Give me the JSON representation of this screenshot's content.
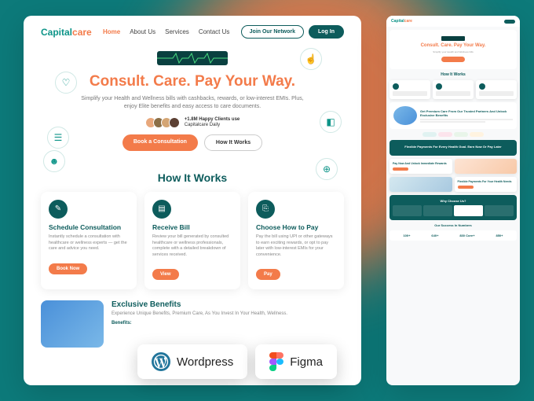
{
  "brand": {
    "part1": "Capital",
    "part2": "care"
  },
  "nav": {
    "items": [
      "Home",
      "About Us",
      "Services",
      "Contact Us"
    ]
  },
  "header_buttons": {
    "join": "Join Our Network",
    "login": "Log In"
  },
  "hero": {
    "title": "Consult. Care. Pay Your Way.",
    "subtitle": "Simplify your Health and Wellness bills with cashbacks, rewards, or low-interest EMIs. Plus, enjoy Elite benefits and easy access to care documents.",
    "social_proof_line1": "+1.8M Happy Clients use",
    "social_proof_line2": "Capitalcare Daily",
    "cta_primary": "Book a Consultation",
    "cta_secondary": "How It Works"
  },
  "how_it_works": {
    "title": "How It Works",
    "cards": [
      {
        "title": "Schedule Consultation",
        "desc": "Instantly schedule a consultation with healthcare or wellness experts — get the care and advice you need.",
        "btn": "Book Now"
      },
      {
        "title": "Receive Bill",
        "desc": "Review your bill generated by consulted healthcare or wellness professionals, complete with a detailed breakdown of services received.",
        "btn": "View"
      },
      {
        "title": "Choose How to Pay",
        "desc": "Pay the bill using UPI or other gateways to earn exciting rewards, or opt to pay later with low-interest EMIs for your convenience.",
        "btn": "Pay"
      }
    ]
  },
  "benefits": {
    "title": "Exclusive Benefits",
    "subtitle": "Experience Unique Benefits, Premium Care, As You Invest In Your Health, Wellness.",
    "label": "Benefits:"
  },
  "tools": {
    "wordpress": "Wordpress",
    "figma": "Figma"
  },
  "side": {
    "hero_title": "Consult. Care. Pay Your Way.",
    "how_title": "How It Works",
    "premium_title": "Get Premium Care From Our Trusted Partners And Unlock Exclusive Benefits",
    "flex_title": "Flexible Payments For Every Health Goal. Earn Now Or Pay Later",
    "pay_now": "Pay Now And Unlock Immediate Rewards",
    "flex2": "Flexible Payments For Your Health Needs",
    "why": "Why Choose Us?",
    "success": "Our Success In Numbers",
    "stats": [
      "100+",
      "640+",
      "830 Core+",
      "850+"
    ]
  },
  "colors": {
    "teal": "#0d9488",
    "dark_teal": "#0d5c5c",
    "orange": "#f37b4a"
  }
}
